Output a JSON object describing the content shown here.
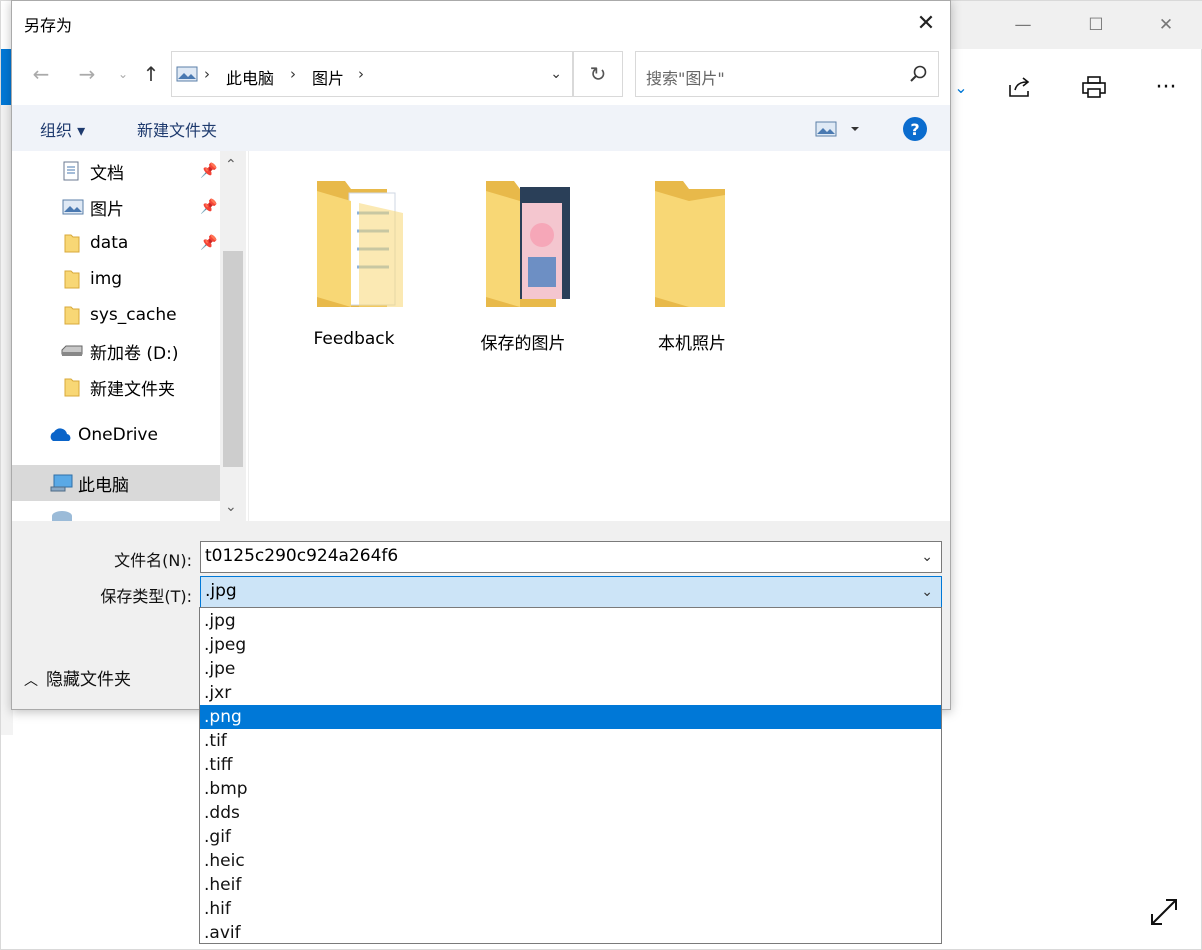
{
  "dialog": {
    "title": "另存为",
    "close_glyph": "✕"
  },
  "address": {
    "crumbs": [
      "此电脑",
      "图片"
    ],
    "search_placeholder": "搜索\"图片\""
  },
  "commands": {
    "organize": "组织 ▾",
    "new_folder": "新建文件夹",
    "help": "?"
  },
  "nav": {
    "items": [
      {
        "label": "文档",
        "icon": "document-icon",
        "pinned": true
      },
      {
        "label": "图片",
        "icon": "pictures-icon",
        "pinned": true
      },
      {
        "label": "data",
        "icon": "folder-icon",
        "pinned": true
      },
      {
        "label": "img",
        "icon": "folder-icon",
        "pinned": false
      },
      {
        "label": "sys_cache",
        "icon": "folder-icon",
        "pinned": false
      },
      {
        "label": "新加卷 (D:)",
        "icon": "drive-icon",
        "pinned": false
      },
      {
        "label": "新建文件夹",
        "icon": "folder-icon",
        "pinned": false
      },
      {
        "label": "OneDrive",
        "icon": "cloud-icon",
        "pinned": false
      },
      {
        "label": "此电脑",
        "icon": "computer-icon",
        "pinned": false
      }
    ]
  },
  "folders": [
    {
      "label": "Feedback"
    },
    {
      "label": "保存的图片"
    },
    {
      "label": "本机照片"
    }
  ],
  "form": {
    "filename_label": "文件名(N):",
    "filename_value": "t0125c290c924a264f6",
    "filetype_label": "保存类型(T):",
    "filetype_value": ".jpg",
    "hide_folders": "隐藏文件夹"
  },
  "file_types": [
    ".jpg",
    ".jpeg",
    ".jpe",
    ".jxr",
    ".png",
    ".tif",
    ".tiff",
    ".bmp",
    ".dds",
    ".gif",
    ".heic",
    ".heif",
    ".hif",
    ".avif"
  ],
  "file_types_highlighted": ".png",
  "colors": {
    "accent": "#0078d7",
    "selection_bg": "#cce4f7",
    "folder": "#f8d775"
  }
}
